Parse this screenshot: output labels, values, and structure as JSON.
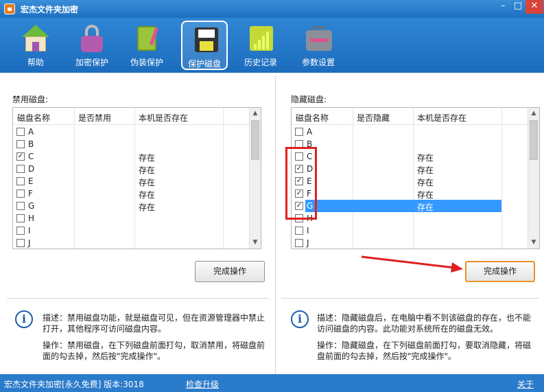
{
  "window": {
    "title": "宏杰文件夹加密",
    "min": "–",
    "max": "□",
    "close": "✕"
  },
  "toolbar": {
    "items": [
      {
        "label": "帮助",
        "icon": "home-icon"
      },
      {
        "label": "加密保护",
        "icon": "lock-icon"
      },
      {
        "label": "伪装保护",
        "icon": "book-icon"
      },
      {
        "label": "保护磁盘",
        "icon": "floppy-disk-icon",
        "active": true
      },
      {
        "label": "历史记录",
        "icon": "history-chart-icon"
      },
      {
        "label": "参数设置",
        "icon": "toolbox-icon"
      }
    ]
  },
  "left": {
    "title": "禁用磁盘:",
    "columns": [
      "磁盘名称",
      "是否禁用",
      "本机是否存在"
    ],
    "rows": [
      {
        "drive": "A",
        "checked": false,
        "exists": ""
      },
      {
        "drive": "B",
        "checked": false,
        "exists": ""
      },
      {
        "drive": "C",
        "checked": true,
        "exists": "存在"
      },
      {
        "drive": "D",
        "checked": false,
        "exists": "存在"
      },
      {
        "drive": "E",
        "checked": false,
        "exists": "存在"
      },
      {
        "drive": "F",
        "checked": false,
        "exists": "存在"
      },
      {
        "drive": "G",
        "checked": false,
        "exists": "存在"
      },
      {
        "drive": "H",
        "checked": false,
        "exists": ""
      },
      {
        "drive": "I",
        "checked": false,
        "exists": ""
      },
      {
        "drive": "J",
        "checked": false,
        "exists": ""
      }
    ],
    "button": "完成操作",
    "desc": "描述：禁用磁盘功能，就是磁盘可见，但在资源管理器中禁止打开，其他程序可访问磁盘内容。",
    "op": "操作：禁用磁盘，在下列磁盘前面打勾，取消禁用，将磁盘前面的勾去掉，然后按\"完成操作\"。"
  },
  "right": {
    "title": "隐藏磁盘:",
    "columns": [
      "磁盘名称",
      "是否隐藏",
      "本机是否存在"
    ],
    "rows": [
      {
        "drive": "A",
        "checked": false,
        "exists": ""
      },
      {
        "drive": "B",
        "checked": false,
        "exists": ""
      },
      {
        "drive": "C",
        "checked": false,
        "exists": "存在"
      },
      {
        "drive": "D",
        "checked": true,
        "exists": "存在"
      },
      {
        "drive": "E",
        "checked": true,
        "exists": "存在"
      },
      {
        "drive": "F",
        "checked": true,
        "exists": "存在"
      },
      {
        "drive": "G",
        "checked": true,
        "exists": "存在",
        "selected": true
      },
      {
        "drive": "H",
        "checked": false,
        "exists": ""
      },
      {
        "drive": "I",
        "checked": false,
        "exists": ""
      },
      {
        "drive": "J",
        "checked": false,
        "exists": ""
      }
    ],
    "button": "完成操作",
    "desc": "描述：隐藏磁盘后，在电脑中看不到该磁盘的存在，也不能访问磁盘的内容。此功能对系统所在的磁盘无效。",
    "op": "操作：隐藏磁盘，在下列磁盘前面打勾，要取消隐藏，将磁盘前面的勾去掉，然后按\"完成操作\"。"
  },
  "status": {
    "left": "宏杰文件夹加密[永久免费]  版本:3018",
    "link": "检查升级",
    "about": "关于"
  },
  "colors": {
    "title_bar": "#2b7bcb",
    "selection": "#3399ff",
    "annotation": "#e02020"
  }
}
